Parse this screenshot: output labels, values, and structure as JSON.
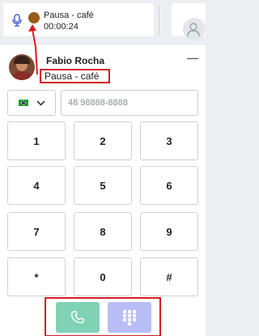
{
  "topbar": {
    "status_label": "Pausa - café",
    "status_timer": "00:00:24",
    "status_color": "#9a5a18",
    "mic_icon": "microphone-icon"
  },
  "dialer": {
    "user_name": "Fabio Rocha",
    "user_status": "Pausa - café",
    "minimize_label": "—",
    "country_flag": "brazil-flag-icon",
    "phone_placeholder": "48 98888-8888",
    "phone_value": "",
    "keys": [
      "1",
      "2",
      "3",
      "4",
      "5",
      "6",
      "7",
      "8",
      "9",
      "*",
      "0",
      "#"
    ]
  },
  "actions": {
    "call_icon": "phone-icon",
    "keypad_icon": "keypad-icon",
    "call_color": "#7fd3b4",
    "keypad_color": "#b9bdf6"
  },
  "annotation_color": "#d71b22"
}
